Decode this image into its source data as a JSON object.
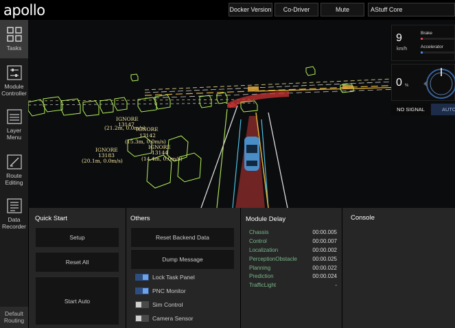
{
  "header": {
    "logo": "apollo",
    "buttons": [
      "Docker Version",
      "Co-Driver",
      "Mute"
    ],
    "vehicle_select": "AStuff Core"
  },
  "sidebar": {
    "items": [
      {
        "label": "Tasks",
        "icon": "grid-icon"
      },
      {
        "label": "Module Controller",
        "icon": "sliders-icon"
      },
      {
        "label": "Layer Menu",
        "icon": "layers-icon"
      },
      {
        "label": "Route Editing",
        "icon": "route-edit-icon"
      },
      {
        "label": "Data Recorder",
        "icon": "document-icon"
      }
    ],
    "bottom": "Default Routing"
  },
  "scene": {
    "labels": [
      {
        "tag": "IGNORE",
        "id": "13147",
        "info": "(21.2m, 0.0m/s)"
      },
      {
        "tag": "IGNORE",
        "id": "13142",
        "info": "(15.3m, 0.0m/s)"
      },
      {
        "tag": "IGNORE",
        "id": "13183",
        "info": "(20.1m, 0.0m/s)"
      },
      {
        "tag": "IGNORE",
        "id": "13144",
        "info": "(14.4m, 0.0m/s)"
      }
    ]
  },
  "hud": {
    "speed": "9",
    "speed_unit": "km/h",
    "brake_label": "Brake",
    "accelerator_label": "Accelerator",
    "steering": "0",
    "steering_unit": "%",
    "signal": "NO SIGNAL",
    "mode": "AUTO"
  },
  "quick_start": {
    "title": "Quick Start",
    "buttons": [
      "Setup",
      "Reset All",
      "Start Auto"
    ]
  },
  "others": {
    "title": "Others",
    "buttons": [
      "Reset Backend Data",
      "Dump Message"
    ],
    "toggles": [
      {
        "label": "Lock Task Panel",
        "on": true
      },
      {
        "label": "PNC Monitor",
        "on": true
      },
      {
        "label": "Sim Control",
        "on": false
      },
      {
        "label": "Camera Sensor",
        "on": false
      }
    ]
  },
  "module_delay": {
    "title": "Module Delay",
    "rows": [
      {
        "name": "Chassis",
        "value": "00:00.005"
      },
      {
        "name": "Control",
        "value": "00:00.007"
      },
      {
        "name": "Localization",
        "value": "00:00.002"
      },
      {
        "name": "PerceptionObstacle",
        "value": "00:00.025"
      },
      {
        "name": "Planning",
        "value": "00:00.022"
      },
      {
        "name": "Prediction",
        "value": "00:00.024"
      },
      {
        "name": "TrafficLight",
        "value": "-"
      }
    ]
  },
  "console": {
    "title": "Console"
  },
  "colors": {
    "accent_blue": "#2c4e80",
    "delay_green": "#79b78a",
    "obstacle_green": "#b5f25a",
    "label_yellow": "#f3e7a0"
  }
}
